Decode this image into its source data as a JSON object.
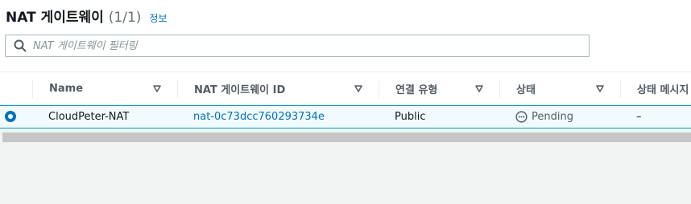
{
  "header": {
    "title": "NAT 게이트웨이",
    "count": "(1/1)",
    "info_link": "정보"
  },
  "search": {
    "placeholder": "NAT 게이트웨이 필터링",
    "value": "",
    "icon": "search-icon"
  },
  "table": {
    "columns": [
      {
        "label": "Name"
      },
      {
        "label": "NAT 게이트웨이 ID"
      },
      {
        "label": "연결 유형"
      },
      {
        "label": "상태"
      },
      {
        "label": "상태 메시지"
      }
    ],
    "rows": [
      {
        "selected": true,
        "name": "CloudPeter-NAT",
        "nat_id": "nat-0c73dcc760293734e",
        "connectivity": "Public",
        "state": "Pending",
        "state_icon": "pending-icon",
        "state_message": "–"
      }
    ]
  },
  "colors": {
    "accent": "#0073bb",
    "selected_row_bg": "#f1faff",
    "selected_row_border": "#00a1c9",
    "page_bg": "#f2f3f3",
    "scrollbar": "#c6c6c6"
  }
}
